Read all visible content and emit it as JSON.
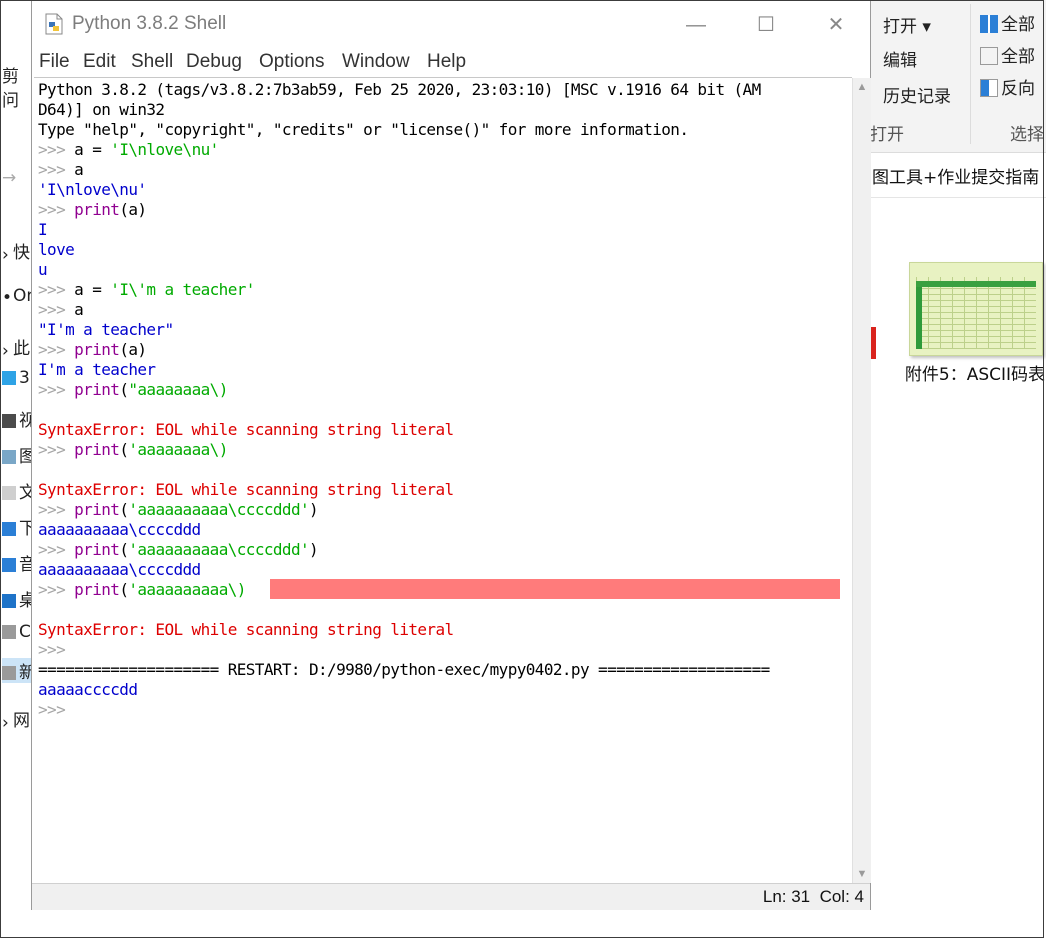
{
  "window": {
    "title": "Python 3.8.2 Shell",
    "minimize": "—",
    "maximize": "☐",
    "close": "✕"
  },
  "menu": [
    "File",
    "Edit",
    "Shell",
    "Debug",
    "Options",
    "Window",
    "Help"
  ],
  "shell_lines": [
    {
      "segs": [
        {
          "t": "Python 3.8.2 (tags/v3.8.2:7b3ab59, Feb 25 2020, 23:03:10) [MSC v.1916 64 bit (AM",
          "c": "black"
        }
      ]
    },
    {
      "segs": [
        {
          "t": "D64)] on win32",
          "c": "black"
        }
      ]
    },
    {
      "segs": [
        {
          "t": "Type \"help\", \"copyright\", \"credits\" or \"license()\" for more information.",
          "c": "black"
        }
      ]
    },
    {
      "segs": [
        {
          "t": ">>> ",
          "c": "prompt"
        },
        {
          "t": "a = ",
          "c": "black"
        },
        {
          "t": "'I\\nlove\\nu'",
          "c": "green"
        }
      ]
    },
    {
      "segs": [
        {
          "t": ">>> ",
          "c": "prompt"
        },
        {
          "t": "a",
          "c": "black"
        }
      ]
    },
    {
      "segs": [
        {
          "t": "'I\\nlove\\nu'",
          "c": "blue"
        }
      ]
    },
    {
      "segs": [
        {
          "t": ">>> ",
          "c": "prompt"
        },
        {
          "t": "print",
          "c": "purple"
        },
        {
          "t": "(a)",
          "c": "black"
        }
      ]
    },
    {
      "segs": [
        {
          "t": "I",
          "c": "blue"
        }
      ]
    },
    {
      "segs": [
        {
          "t": "love",
          "c": "blue"
        }
      ]
    },
    {
      "segs": [
        {
          "t": "u",
          "c": "blue"
        }
      ]
    },
    {
      "segs": [
        {
          "t": ">>> ",
          "c": "prompt"
        },
        {
          "t": "a = ",
          "c": "black"
        },
        {
          "t": "'I\\'m a teacher'",
          "c": "green"
        }
      ]
    },
    {
      "segs": [
        {
          "t": ">>> ",
          "c": "prompt"
        },
        {
          "t": "a",
          "c": "black"
        }
      ]
    },
    {
      "segs": [
        {
          "t": "\"I'm a teacher\"",
          "c": "blue"
        }
      ]
    },
    {
      "segs": [
        {
          "t": ">>> ",
          "c": "prompt"
        },
        {
          "t": "print",
          "c": "purple"
        },
        {
          "t": "(a)",
          "c": "black"
        }
      ]
    },
    {
      "segs": [
        {
          "t": "I'm a teacher",
          "c": "blue"
        }
      ]
    },
    {
      "segs": [
        {
          "t": ">>> ",
          "c": "prompt"
        },
        {
          "t": "print",
          "c": "purple"
        },
        {
          "t": "(",
          "c": "black"
        },
        {
          "t": "\"aaaaaaaa\\)",
          "c": "green"
        }
      ]
    },
    {
      "segs": [
        {
          "t": "",
          "c": "black"
        }
      ]
    },
    {
      "segs": [
        {
          "t": "SyntaxError: EOL while scanning string literal",
          "c": "red"
        }
      ]
    },
    {
      "segs": [
        {
          "t": ">>> ",
          "c": "prompt"
        },
        {
          "t": "print",
          "c": "purple"
        },
        {
          "t": "(",
          "c": "black"
        },
        {
          "t": "'aaaaaaaa\\)",
          "c": "green"
        }
      ]
    },
    {
      "segs": [
        {
          "t": "",
          "c": "black"
        }
      ]
    },
    {
      "segs": [
        {
          "t": "SyntaxError: EOL while scanning string literal",
          "c": "red"
        }
      ]
    },
    {
      "segs": [
        {
          "t": ">>> ",
          "c": "prompt"
        },
        {
          "t": "print",
          "c": "purple"
        },
        {
          "t": "(",
          "c": "black"
        },
        {
          "t": "'aaaaaaaaaa\\ccccddd'",
          "c": "green"
        },
        {
          "t": ")",
          "c": "black"
        }
      ]
    },
    {
      "segs": [
        {
          "t": "aaaaaaaaaa\\ccccddd",
          "c": "blue"
        }
      ]
    },
    {
      "segs": [
        {
          "t": ">>> ",
          "c": "prompt"
        },
        {
          "t": "print",
          "c": "purple"
        },
        {
          "t": "(",
          "c": "black"
        },
        {
          "t": "'aaaaaaaaaa\\ccccddd'",
          "c": "green"
        },
        {
          "t": ")",
          "c": "black"
        }
      ]
    },
    {
      "segs": [
        {
          "t": "aaaaaaaaaa\\ccccddd",
          "c": "blue"
        }
      ]
    },
    {
      "segs": [
        {
          "t": ">>> ",
          "c": "prompt"
        },
        {
          "t": "print",
          "c": "purple"
        },
        {
          "t": "(",
          "c": "black"
        },
        {
          "t": "'aaaaaaaaaa\\)",
          "c": "green"
        }
      ]
    },
    {
      "segs": [
        {
          "t": "",
          "c": "black"
        }
      ]
    },
    {
      "segs": [
        {
          "t": "SyntaxError: EOL while scanning string literal",
          "c": "red"
        }
      ]
    },
    {
      "segs": [
        {
          "t": ">>> ",
          "c": "prompt"
        }
      ]
    },
    {
      "segs": [
        {
          "t": "==================== RESTART: D:/9980/python-exec/mypy0402.py ===================",
          "c": "black"
        }
      ]
    },
    {
      "segs": [
        {
          "t": "aaaaaccccdd",
          "c": "blue"
        }
      ]
    },
    {
      "segs": [
        {
          "t": ">>> ",
          "c": "prompt"
        }
      ]
    }
  ],
  "status": {
    "ln": "Ln: 31",
    "col": "Col: 4"
  },
  "explorer": {
    "ribbon": {
      "open": "打开",
      "edit": "编辑",
      "history": "历史记录",
      "open_group": "打开",
      "select_all": "全部",
      "select_none": "全部",
      "invert": "反向",
      "select_group": "选择"
    },
    "path": "图工具+作业提交指南",
    "file_label": "附件5：ASCII码表",
    "left_fragments": [
      "剪",
      "问",
      "快",
      "On",
      "此",
      "3",
      "视",
      "图",
      "文",
      "下",
      "音",
      "桌",
      "C",
      "新",
      "网"
    ]
  },
  "colors": {
    "error_highlight": "#ff7b7b",
    "prompt": "#a6a6a6",
    "keyword": "#900090",
    "string": "#00aa00",
    "output": "#0000cc",
    "error": "#dd0000"
  }
}
